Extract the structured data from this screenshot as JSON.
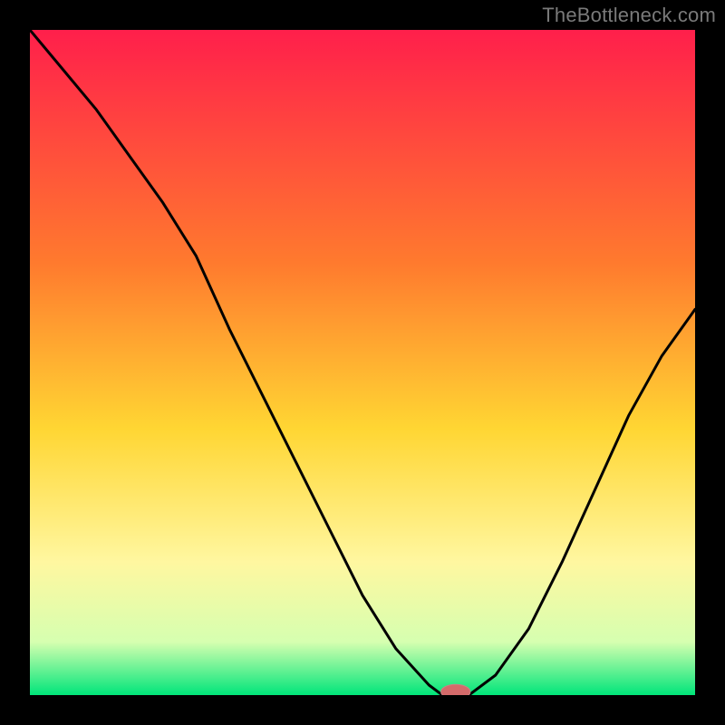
{
  "watermark": "TheBottleneck.com",
  "colors": {
    "frame": "#000000",
    "line": "#000000",
    "marker_fill": "#d46a6a",
    "marker_stroke": "#c68484",
    "gradient_top": "#ff1f4b",
    "gradient_mid1": "#ff7a2e",
    "gradient_mid2": "#ffd633",
    "gradient_mid3": "#fff7a0",
    "gradient_mid4": "#d6ffb0",
    "gradient_bottom": "#00e57a"
  },
  "chart_data": {
    "type": "line",
    "title": "",
    "xlabel": "",
    "ylabel": "",
    "xlim": [
      0,
      100
    ],
    "ylim": [
      0,
      100
    ],
    "x": [
      0,
      5,
      10,
      15,
      20,
      25,
      30,
      35,
      40,
      45,
      50,
      55,
      60,
      62,
      64,
      66,
      70,
      75,
      80,
      85,
      90,
      95,
      100
    ],
    "values": [
      100,
      94,
      88,
      81,
      74,
      66,
      55,
      45,
      35,
      25,
      15,
      7,
      1.5,
      0,
      0,
      0,
      3,
      10,
      20,
      31,
      42,
      51,
      58
    ],
    "marker": {
      "x": 64,
      "y": 0.5,
      "rx": 2.2,
      "ry": 1.1
    }
  }
}
